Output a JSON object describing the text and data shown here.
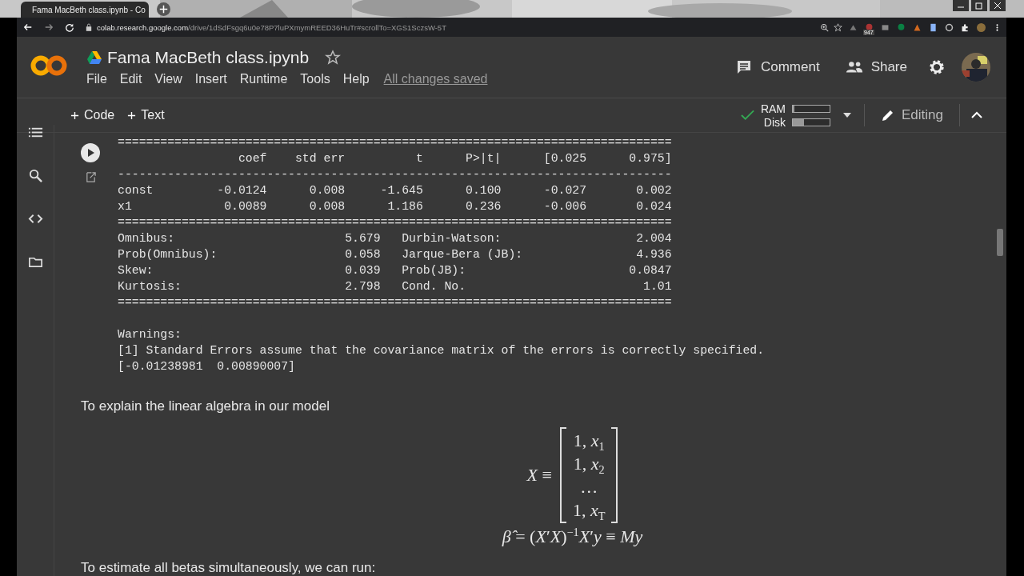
{
  "browser": {
    "tab_title": "Fama MacBeth class.ipynb - Co",
    "url_host": "colab.research.google.com",
    "url_path": "/drive/1dSdFsgq6u0e78P7luPXmymREED36HuTr#scrollTo=XGS1SczsW-5T",
    "extension_badge": "947"
  },
  "notebook": {
    "title": "Fama MacBeth class.ipynb",
    "menu": [
      "File",
      "Edit",
      "View",
      "Insert",
      "Runtime",
      "Tools",
      "Help"
    ],
    "save_status": "All changes saved",
    "comment": "Comment",
    "share": "Share"
  },
  "toolbar": {
    "add_buttons": [
      "Code",
      "Text"
    ],
    "resources": [
      {
        "label": "RAM",
        "level": 0.05
      },
      {
        "label": "Disk",
        "level": 0.3
      }
    ],
    "mode": "Editing"
  },
  "output_lines": [
    "==============================================================================",
    "                 coef    std err          t      P>|t|      [0.025      0.975]",
    "------------------------------------------------------------------------------",
    "const         -0.0124      0.008     -1.645      0.100      -0.027       0.002",
    "x1             0.0089      0.008      1.186      0.236      -0.006       0.024",
    "==============================================================================",
    "Omnibus:                        5.679   Durbin-Watson:                   2.004",
    "Prob(Omnibus):                  0.058   Jarque-Bera (JB):                4.936",
    "Skew:                           0.039   Prob(JB):                       0.0847",
    "Kurtosis:                       2.798   Cond. No.                         1.01",
    "=============================================================================="
  ],
  "warning_lines": [
    "Warnings:",
    "[1] Standard Errors assume that the covariance matrix of the errors is correctly specified.",
    "[-0.01238981  0.00890007]"
  ],
  "text_cell": {
    "intro": "To explain the linear algebra in our model",
    "matrix_lhs": "*X* ≡",
    "matrix_rows": [
      "1, *x*$_{1}$",
      "1, *x*$_{2}$",
      "…",
      "1, *x*$_{T}$"
    ],
    "beta_formula": "*β̂* = (*X*′*X*)$^{−1}$*X*′*y* ≡ *My*",
    "next": "To estimate all betas simultaneously, we can run:"
  }
}
